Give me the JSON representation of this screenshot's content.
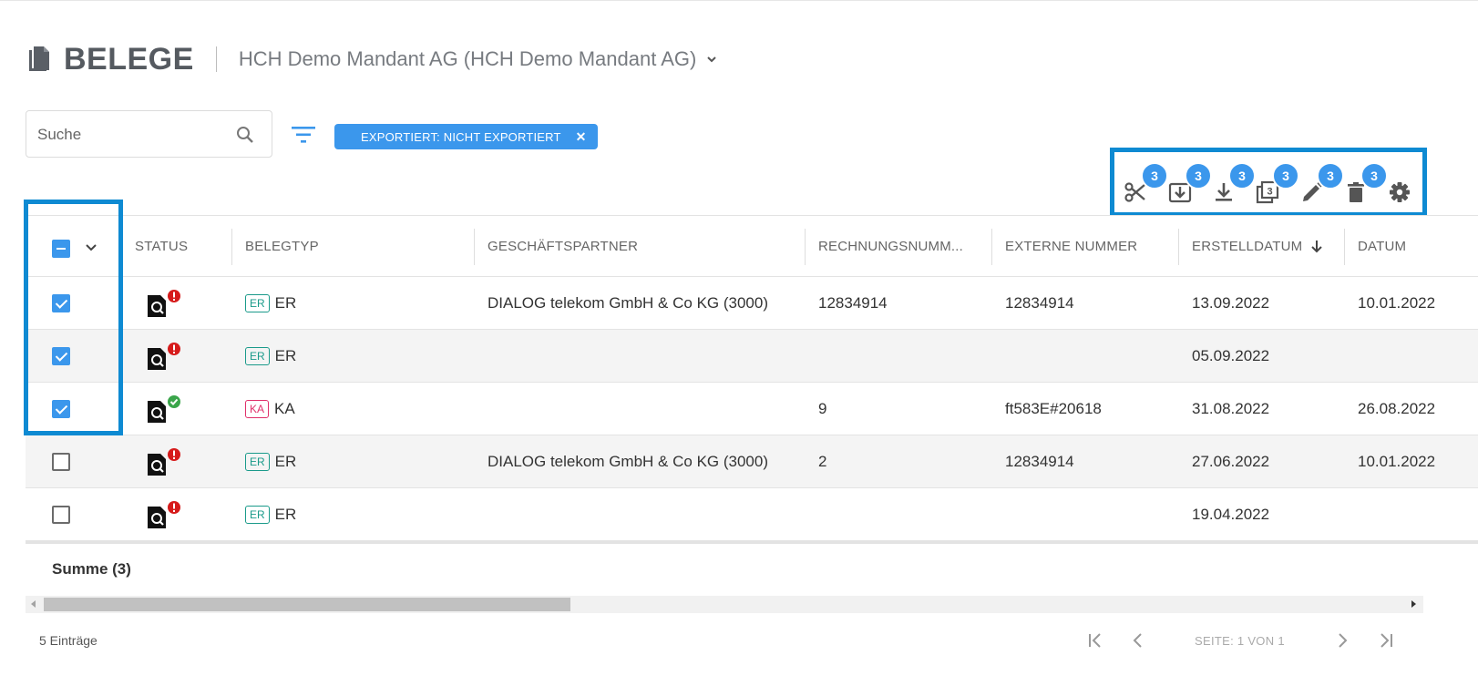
{
  "header": {
    "title": "BELEGE",
    "mandant": "HCH Demo Mandant AG (HCH Demo Mandant AG)"
  },
  "search": {
    "placeholder": "Suche"
  },
  "filter_chip": {
    "label": "EXPORTIERT: NICHT EXPORTIERT",
    "close": "✕"
  },
  "toolbar": {
    "badge_count": "3",
    "tools": [
      "scissors-icon",
      "import-icon",
      "download-icon",
      "copy-icon",
      "edit-icon",
      "delete-icon",
      "settings-icon"
    ]
  },
  "columns": {
    "status": "STATUS",
    "belegtyp": "BELEGTYP",
    "partner": "GESCHÄFTSPARTNER",
    "rechnung": "RECHNUNGSNUMM...",
    "extern": "EXTERNE NUMMER",
    "erstelldatum": "ERSTELLDATUM",
    "datum": "DATUM"
  },
  "rows": [
    {
      "checked": true,
      "status": "error",
      "typ": "ER",
      "typ_text": "ER",
      "partner": "DIALOG telekom GmbH & Co KG (3000)",
      "rechnung": "12834914",
      "extern": "12834914",
      "erstelldatum": "13.09.2022",
      "datum": "10.01.2022"
    },
    {
      "checked": true,
      "status": "error",
      "typ": "ER",
      "typ_text": "ER",
      "partner": "",
      "rechnung": "",
      "extern": "",
      "erstelldatum": "05.09.2022",
      "datum": ""
    },
    {
      "checked": true,
      "status": "ok",
      "typ": "KA",
      "typ_text": "KA",
      "partner": "",
      "rechnung": "9",
      "extern": "ft583E#20618",
      "erstelldatum": "31.08.2022",
      "datum": "26.08.2022"
    },
    {
      "checked": false,
      "status": "error",
      "typ": "ER",
      "typ_text": "ER",
      "partner": "DIALOG telekom GmbH & Co KG (3000)",
      "rechnung": "2",
      "extern": "12834914",
      "erstelldatum": "27.06.2022",
      "datum": "10.01.2022"
    },
    {
      "checked": false,
      "status": "error",
      "typ": "ER",
      "typ_text": "ER",
      "partner": "",
      "rechnung": "",
      "extern": "",
      "erstelldatum": "19.04.2022",
      "datum": ""
    }
  ],
  "summary": {
    "label": "Summe (3)"
  },
  "footer": {
    "count": "5 Einträge",
    "page": "SEITE: 1 VON 1"
  },
  "colors": {
    "accent": "#3b97ec",
    "highlight_border": "#0e8ad2",
    "error": "#d61b1b",
    "ok": "#3aa54a",
    "er_badge": "#1a9a8a",
    "ka_badge": "#e0306a"
  }
}
